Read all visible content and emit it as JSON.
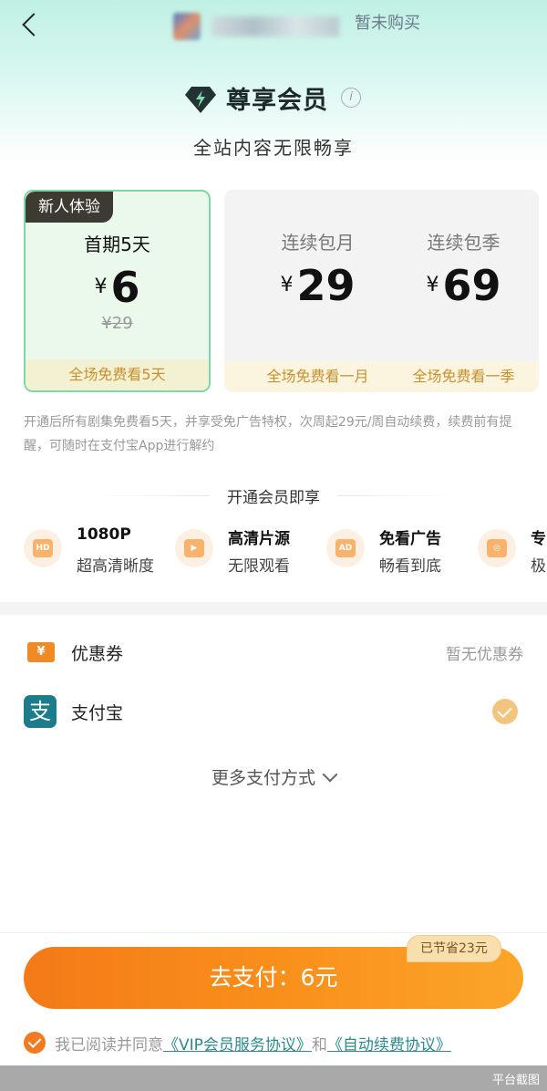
{
  "header": {
    "not_purchased": "暂未购买"
  },
  "vip": {
    "title": "尊享会员",
    "info_glyph": "i",
    "subtitle": "全站内容无限畅享"
  },
  "plans": [
    {
      "badge": "新人体验",
      "name": "首期5天",
      "currency": "¥",
      "price": "6",
      "original": "¥29",
      "note": "全场免费看5天",
      "selected": true
    },
    {
      "name": "连续包月",
      "currency": "¥",
      "price": "29",
      "note": "全场免费看一月",
      "selected": false
    },
    {
      "name": "连续包季",
      "currency": "¥",
      "price": "69",
      "note": "全场免费看一季",
      "selected": false
    }
  ],
  "terms": "开通后所有剧集免费看5天，并享受免广告特权，次周起29元/周自动续费，续费前有提醒，可随时在支付宝App进行解约",
  "benefits": {
    "title": "开通会员即享",
    "items": [
      {
        "icon": "hd-icon",
        "glyph": "HD",
        "title": "1080P",
        "desc": "超高清晰度"
      },
      {
        "icon": "video-icon",
        "glyph": "▶",
        "title": "高清片源",
        "desc": "无限观看"
      },
      {
        "icon": "no-ad-icon",
        "glyph": "AD",
        "title": "免看广告",
        "desc": "畅看到底"
      },
      {
        "icon": "headset-icon",
        "glyph": "◎",
        "title": "专",
        "desc": "极"
      }
    ]
  },
  "coupon": {
    "glyph": "¥",
    "label": "优惠券",
    "value": "暂无优惠券"
  },
  "alipay": {
    "glyph": "支",
    "label": "支付宝"
  },
  "more_payment": "更多支付方式",
  "save_tag": "已节省23元",
  "pay_button": "去支付：6元",
  "agreement": {
    "prefix": "我已阅读并同意",
    "link1": "《VIP会员服务协议》",
    "and": "和",
    "link2": "《自动续费协议》"
  },
  "platform_watermark": "平台截图",
  "colors": {
    "accent": "#f47a18",
    "selected_border": "#7fd6a8",
    "link": "#2c8a8d",
    "gold": "#c7902e"
  }
}
